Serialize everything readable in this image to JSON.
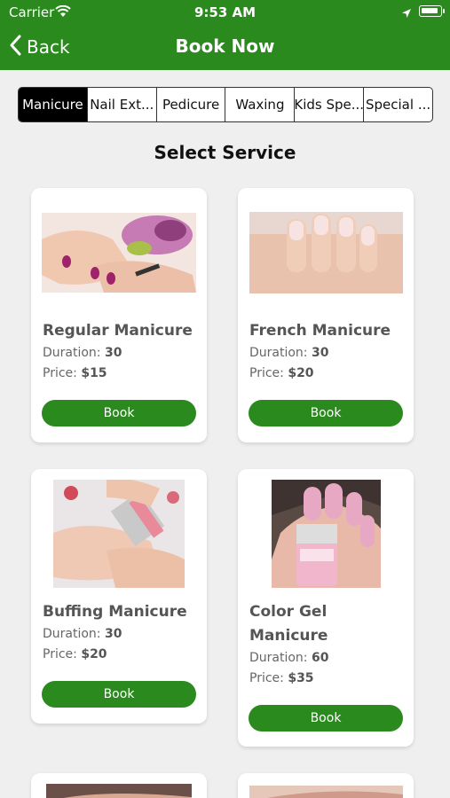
{
  "status": {
    "carrier": "Carrier",
    "time": "9:53 AM"
  },
  "nav": {
    "back_label": "Back",
    "title": "Book Now"
  },
  "tabs": [
    "Manicure",
    "Nail Ext...",
    "Pedicure",
    "Waxing",
    "Kids Spe...",
    "Special ..."
  ],
  "section_title": "Select Service",
  "labels": {
    "duration": "Duration:",
    "price": "Price:",
    "book": "Book"
  },
  "services": [
    {
      "name": "Regular Manicure",
      "duration": "30",
      "price": "$15"
    },
    {
      "name": "French Manicure",
      "duration": "30",
      "price": "$20"
    },
    {
      "name": "Buffing Manicure",
      "duration": "30",
      "price": "$20"
    },
    {
      "name_line1": "Color Gel",
      "name_line2": "Manicure",
      "duration": "60",
      "price": "$35"
    }
  ],
  "colors": {
    "brand_green": "#2a8a1e",
    "background": "#efefef",
    "active_tab": "#000000"
  }
}
